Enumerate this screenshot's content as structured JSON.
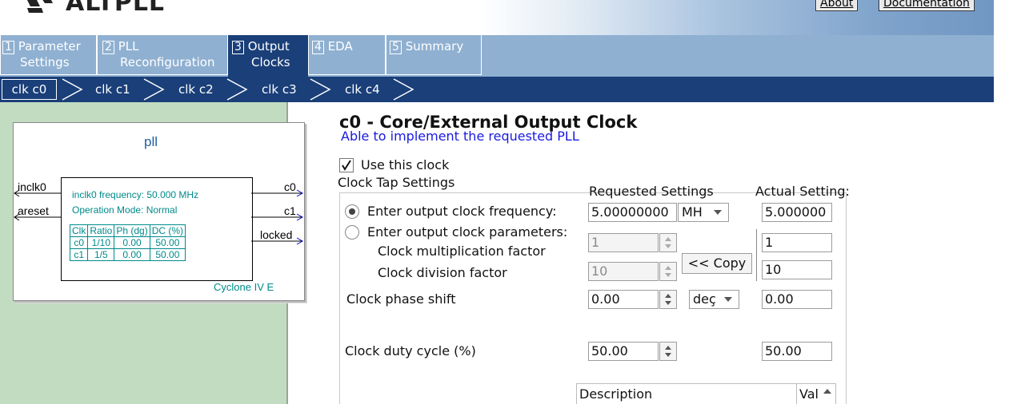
{
  "app": {
    "title": "ALTPLL",
    "about_label": "About",
    "documentation_label": "Documentation"
  },
  "tabs": [
    {
      "num": "1",
      "line1": "Parameter",
      "line2": "Settings"
    },
    {
      "num": "2",
      "line1": "PLL",
      "line2": "Reconfiguration"
    },
    {
      "num": "3",
      "line1": "Output",
      "line2": "Clocks"
    },
    {
      "num": "4",
      "line1": "EDA",
      "line2": ""
    },
    {
      "num": "5",
      "line1": "Summary",
      "line2": ""
    }
  ],
  "active_tab_index": 2,
  "clock_tabs": [
    "clk c0",
    "clk c1",
    "clk c2",
    "clk c3",
    "clk c4"
  ],
  "pll_diagram": {
    "title": "pll",
    "inputs": [
      "inclk0",
      "areset"
    ],
    "outputs": [
      "c0",
      "c1",
      "locked"
    ],
    "info_line1": "inclk0 frequency: 50.000 MHz",
    "info_line2": "Operation Mode: Normal",
    "table_headers": [
      "Clk",
      "Ratio",
      "Ph (dg)",
      "DC (%)"
    ],
    "table_rows": [
      [
        "c0",
        "1/10",
        "0.00",
        "50.00"
      ],
      [
        "c1",
        "1/5",
        "0.00",
        "50.00"
      ]
    ],
    "device": "Cyclone IV E"
  },
  "main": {
    "heading": "c0 - Core/External Output Clock",
    "status": "Able to implement the requested PLL",
    "use_clock_label": "Use this clock",
    "use_clock_checked": true,
    "clock_tap_label": "Clock Tap Settings",
    "requested_header": "Requested Settings",
    "actual_header": "Actual Setting:",
    "freq_radio_label": "Enter output clock frequency:",
    "freq_value": "5.00000000",
    "freq_unit": "MH",
    "freq_actual": "5.000000",
    "params_radio_label": "Enter output clock parameters:",
    "mult_label": "Clock multiplication factor",
    "mult_value": "1",
    "mult_actual": "1",
    "div_label": "Clock division factor",
    "div_value": "10",
    "div_actual": "10",
    "copy_label": "<< Copy",
    "phase_label": "Clock phase shift",
    "phase_value": "0.00",
    "phase_unit": "deç",
    "phase_actual": "0.00",
    "duty_label": "Clock duty cycle (%)",
    "duty_value": "50.00",
    "duty_actual": "50.00",
    "table_header_desc": "Description",
    "table_header_val": "Val"
  },
  "colors": {
    "nav_dark": "#1a3f79",
    "nav_light": "#8fb0d1",
    "diagram_teal": "#008a8a",
    "left_panel_green": "#c2dcc2"
  }
}
